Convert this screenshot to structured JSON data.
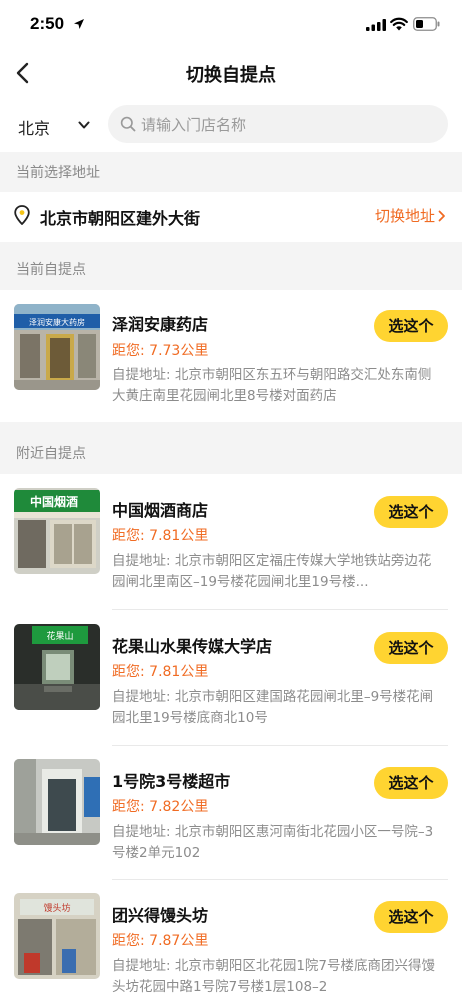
{
  "status_bar": {
    "time": "2:50"
  },
  "nav": {
    "title": "切换自提点"
  },
  "search": {
    "city": "北京",
    "placeholder": "请输入门店名称"
  },
  "current_address": {
    "section_title": "当前选择地址",
    "address": "北京市朝阳区建外大街",
    "switch_label": "切换地址"
  },
  "current_pickup": {
    "section_title": "当前自提点",
    "store": {
      "name": "泽润安康药店",
      "distance": "距您: 7.73公里",
      "address": "自提地址: 北京市朝阳区东五环与朝阳路交汇处东南侧大黄庄南里花园闸北里8号楼对面药店",
      "select_label": "选这个",
      "sign_text": "泽润安康大药房"
    }
  },
  "nearby": {
    "section_title": "附近自提点",
    "stores": [
      {
        "name": "中国烟酒商店",
        "distance": "距您: 7.81公里",
        "address": "自提地址: 北京市朝阳区定福庄传媒大学地铁站旁边花园闸北里南区–19号楼花园闸北里19号楼...",
        "select_label": "选这个",
        "sign_text": "中国烟酒"
      },
      {
        "name": "花果山水果传媒大学店",
        "distance": "距您: 7.81公里",
        "address": "自提地址: 北京市朝阳区建国路花园闸北里–9号楼花闸园北里19号楼底商北10号",
        "select_label": "选这个",
        "sign_text": "花果山"
      },
      {
        "name": "1号院3号楼超市",
        "distance": "距您: 7.82公里",
        "address": "自提地址: 北京市朝阳区惠河南街北花园小区一号院–3号楼2单元102",
        "select_label": "选这个"
      },
      {
        "name": "团兴得馒头坊",
        "distance": "距您: 7.87公里",
        "address": "自提地址: 北京市朝阳区北花园1院7号楼底商团兴得馒头坊花园中路1号院7号楼1层108–2",
        "select_label": "选这个",
        "sign_text": "馒头坊"
      }
    ]
  },
  "colors": {
    "accent_orange": "#f06b23",
    "button_yellow": "#ffd431",
    "section_bg": "#f4f4f4"
  }
}
